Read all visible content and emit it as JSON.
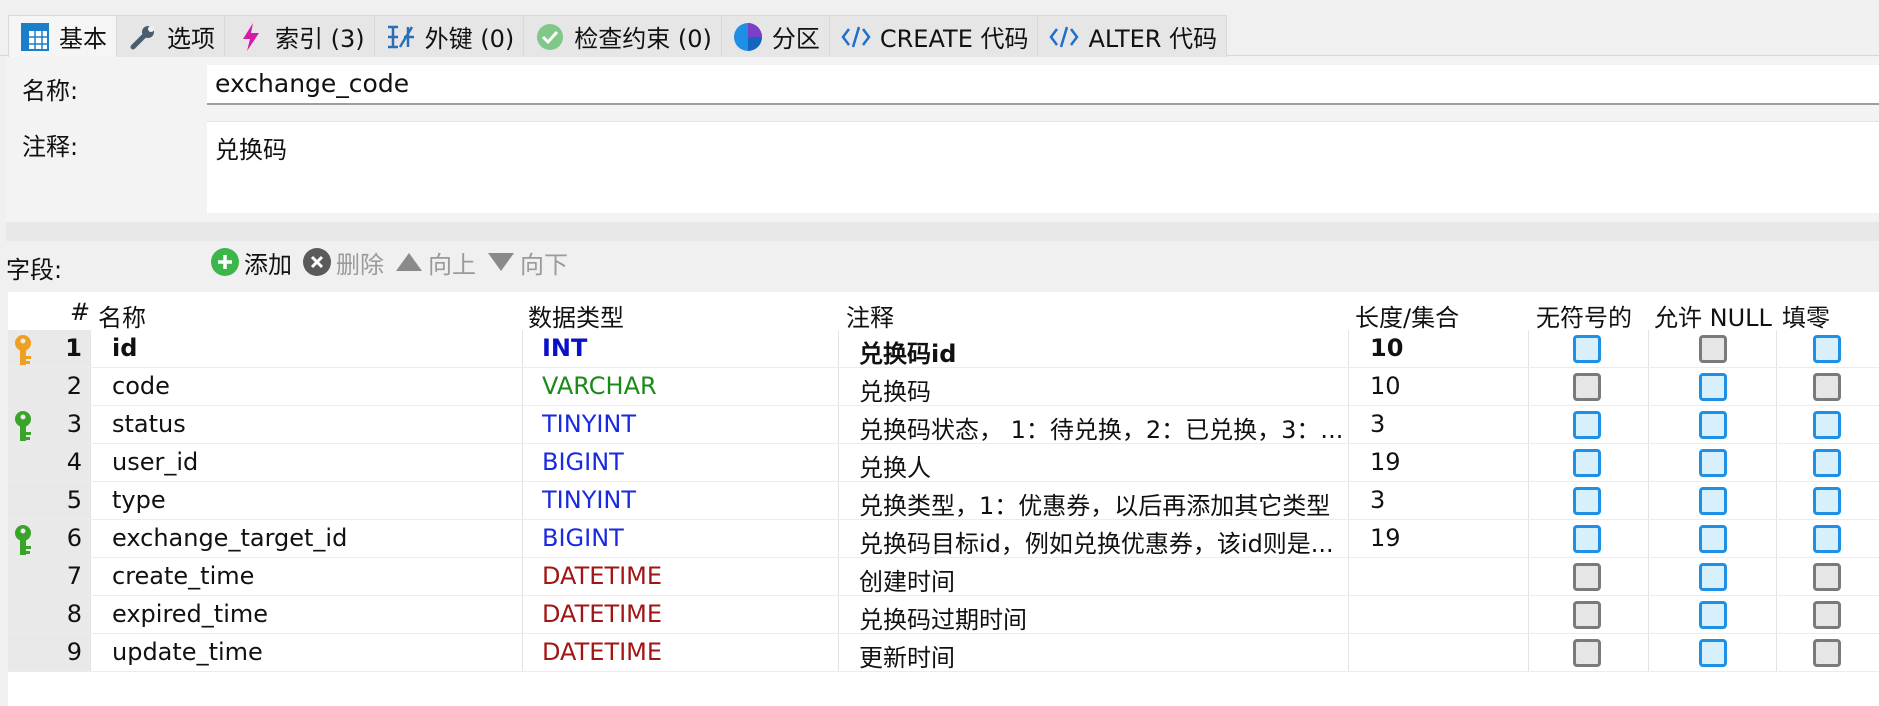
{
  "tabs": [
    {
      "label": "基本",
      "icon": "table-icon"
    },
    {
      "label": "选项",
      "icon": "wrench-icon"
    },
    {
      "label": "索引 (3)",
      "icon": "lightning-icon"
    },
    {
      "label": "外键 (0)",
      "icon": "foreign-key-icon"
    },
    {
      "label": "检查约束 (0)",
      "icon": "check-icon"
    },
    {
      "label": "分区",
      "icon": "partition-icon"
    },
    {
      "label": "CREATE 代码",
      "icon": "code-icon"
    },
    {
      "label": "ALTER 代码",
      "icon": "code-icon"
    }
  ],
  "form": {
    "name_label": "名称:",
    "name_value": "exchange_code",
    "comment_label": "注释:",
    "comment_value": "兑换码"
  },
  "fields_toolbar": {
    "section_label": "字段:",
    "add": "添加",
    "delete": "删除",
    "up": "向上",
    "down": "向下"
  },
  "table": {
    "headers": {
      "num": "#",
      "name": "名称",
      "type": "数据类型",
      "comment": "注释",
      "length": "长度/集合",
      "unsigned": "无符号的",
      "nullable": "允许 NULL",
      "zerofill": "填零"
    },
    "rows": [
      {
        "num": "1",
        "name": "id",
        "type": "INT",
        "comment": "兑换码id",
        "length": "10",
        "key": "primary",
        "unsigned": true,
        "nullable": false,
        "zerofill": true
      },
      {
        "num": "2",
        "name": "code",
        "type": "VARCHAR",
        "comment": "兑换码",
        "length": "10",
        "key": "",
        "unsigned": false,
        "nullable": true,
        "zerofill": false
      },
      {
        "num": "3",
        "name": "status",
        "type": "TINYINT",
        "comment": "兑换码状态， 1：待兑换，2：已兑换，3：...",
        "length": "3",
        "key": "index",
        "unsigned": true,
        "nullable": true,
        "zerofill": true
      },
      {
        "num": "4",
        "name": "user_id",
        "type": "BIGINT",
        "comment": "兑换人",
        "length": "19",
        "key": "",
        "unsigned": true,
        "nullable": true,
        "zerofill": true
      },
      {
        "num": "5",
        "name": "type",
        "type": "TINYINT",
        "comment": "兑换类型，1：优惠券，以后再添加其它类型",
        "length": "3",
        "key": "",
        "unsigned": true,
        "nullable": true,
        "zerofill": true
      },
      {
        "num": "6",
        "name": "exchange_target_id",
        "type": "BIGINT",
        "comment": "兑换码目标id，例如兑换优惠券，该id则是...",
        "length": "19",
        "key": "index",
        "unsigned": true,
        "nullable": true,
        "zerofill": true
      },
      {
        "num": "7",
        "name": "create_time",
        "type": "DATETIME",
        "comment": "创建时间",
        "length": "",
        "key": "",
        "unsigned": false,
        "nullable": true,
        "zerofill": false
      },
      {
        "num": "8",
        "name": "expired_time",
        "type": "DATETIME",
        "comment": "兑换码过期时间",
        "length": "",
        "key": "",
        "unsigned": false,
        "nullable": true,
        "zerofill": false
      },
      {
        "num": "9",
        "name": "update_time",
        "type": "DATETIME",
        "comment": "更新时间",
        "length": "",
        "key": "",
        "unsigned": false,
        "nullable": true,
        "zerofill": false
      }
    ]
  },
  "colors": {
    "INT": "#0a10c8",
    "VARCHAR": "#1a8a1a",
    "TINYINT": "#1a2ae0",
    "BIGINT": "#1a2ae0",
    "DATETIME": "#a31515",
    "primary_key": "#f0a020",
    "index_key": "#3aa32a"
  }
}
